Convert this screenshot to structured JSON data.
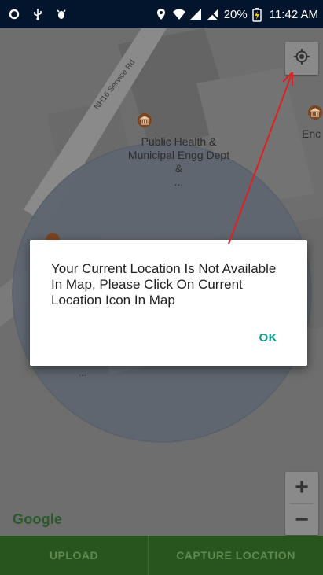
{
  "status_bar": {
    "battery": "20%",
    "time": "11:42 AM"
  },
  "map": {
    "road_label": "NH16 Service Rd",
    "poi_label": "Public Health &\nMunicipal Engg Dept\n&\n...",
    "partial_label": "Enc",
    "small_label": "...",
    "google_logo": "Google",
    "zoom_in": "+",
    "zoom_out": "−"
  },
  "dialog": {
    "message": "Your Current Location Is Not Available In Map, Please Click On Current Location Icon In Map",
    "ok_label": "OK"
  },
  "bottom_bar": {
    "upload_label": "UPLOAD",
    "capture_label": "CAPTURE LOCATION"
  },
  "colors": {
    "status_bar": "#03152c",
    "bottom_bar": "#28541d",
    "accent": "#0a9a8a",
    "annotation_arrow": "#e02020"
  }
}
